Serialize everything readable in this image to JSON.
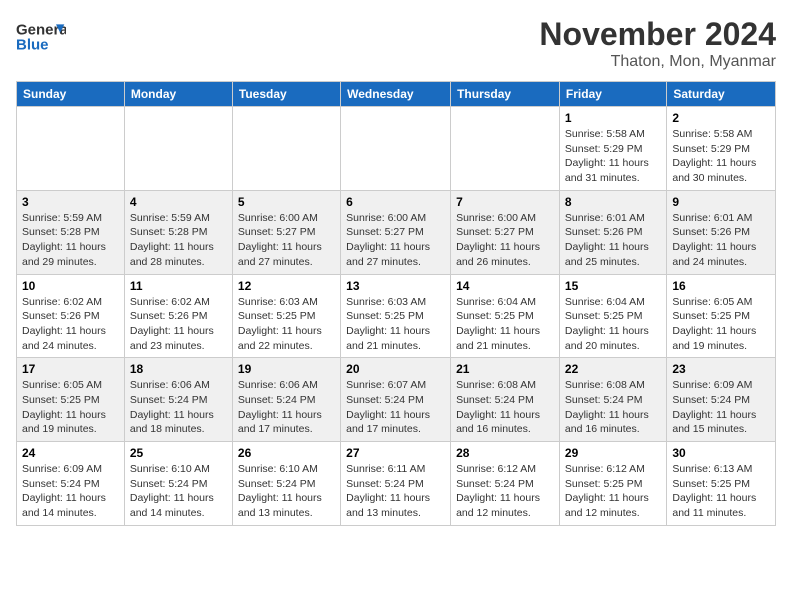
{
  "header": {
    "logo_line1": "General",
    "logo_line2": "Blue",
    "month": "November 2024",
    "location": "Thaton, Mon, Myanmar"
  },
  "days_of_week": [
    "Sunday",
    "Monday",
    "Tuesday",
    "Wednesday",
    "Thursday",
    "Friday",
    "Saturday"
  ],
  "weeks": [
    {
      "days": [
        {
          "num": "",
          "info": ""
        },
        {
          "num": "",
          "info": ""
        },
        {
          "num": "",
          "info": ""
        },
        {
          "num": "",
          "info": ""
        },
        {
          "num": "",
          "info": ""
        },
        {
          "num": "1",
          "info": "Sunrise: 5:58 AM\nSunset: 5:29 PM\nDaylight: 11 hours and 31 minutes."
        },
        {
          "num": "2",
          "info": "Sunrise: 5:58 AM\nSunset: 5:29 PM\nDaylight: 11 hours and 30 minutes."
        }
      ]
    },
    {
      "days": [
        {
          "num": "3",
          "info": "Sunrise: 5:59 AM\nSunset: 5:28 PM\nDaylight: 11 hours and 29 minutes."
        },
        {
          "num": "4",
          "info": "Sunrise: 5:59 AM\nSunset: 5:28 PM\nDaylight: 11 hours and 28 minutes."
        },
        {
          "num": "5",
          "info": "Sunrise: 6:00 AM\nSunset: 5:27 PM\nDaylight: 11 hours and 27 minutes."
        },
        {
          "num": "6",
          "info": "Sunrise: 6:00 AM\nSunset: 5:27 PM\nDaylight: 11 hours and 27 minutes."
        },
        {
          "num": "7",
          "info": "Sunrise: 6:00 AM\nSunset: 5:27 PM\nDaylight: 11 hours and 26 minutes."
        },
        {
          "num": "8",
          "info": "Sunrise: 6:01 AM\nSunset: 5:26 PM\nDaylight: 11 hours and 25 minutes."
        },
        {
          "num": "9",
          "info": "Sunrise: 6:01 AM\nSunset: 5:26 PM\nDaylight: 11 hours and 24 minutes."
        }
      ]
    },
    {
      "days": [
        {
          "num": "10",
          "info": "Sunrise: 6:02 AM\nSunset: 5:26 PM\nDaylight: 11 hours and 24 minutes."
        },
        {
          "num": "11",
          "info": "Sunrise: 6:02 AM\nSunset: 5:26 PM\nDaylight: 11 hours and 23 minutes."
        },
        {
          "num": "12",
          "info": "Sunrise: 6:03 AM\nSunset: 5:25 PM\nDaylight: 11 hours and 22 minutes."
        },
        {
          "num": "13",
          "info": "Sunrise: 6:03 AM\nSunset: 5:25 PM\nDaylight: 11 hours and 21 minutes."
        },
        {
          "num": "14",
          "info": "Sunrise: 6:04 AM\nSunset: 5:25 PM\nDaylight: 11 hours and 21 minutes."
        },
        {
          "num": "15",
          "info": "Sunrise: 6:04 AM\nSunset: 5:25 PM\nDaylight: 11 hours and 20 minutes."
        },
        {
          "num": "16",
          "info": "Sunrise: 6:05 AM\nSunset: 5:25 PM\nDaylight: 11 hours and 19 minutes."
        }
      ]
    },
    {
      "days": [
        {
          "num": "17",
          "info": "Sunrise: 6:05 AM\nSunset: 5:25 PM\nDaylight: 11 hours and 19 minutes."
        },
        {
          "num": "18",
          "info": "Sunrise: 6:06 AM\nSunset: 5:24 PM\nDaylight: 11 hours and 18 minutes."
        },
        {
          "num": "19",
          "info": "Sunrise: 6:06 AM\nSunset: 5:24 PM\nDaylight: 11 hours and 17 minutes."
        },
        {
          "num": "20",
          "info": "Sunrise: 6:07 AM\nSunset: 5:24 PM\nDaylight: 11 hours and 17 minutes."
        },
        {
          "num": "21",
          "info": "Sunrise: 6:08 AM\nSunset: 5:24 PM\nDaylight: 11 hours and 16 minutes."
        },
        {
          "num": "22",
          "info": "Sunrise: 6:08 AM\nSunset: 5:24 PM\nDaylight: 11 hours and 16 minutes."
        },
        {
          "num": "23",
          "info": "Sunrise: 6:09 AM\nSunset: 5:24 PM\nDaylight: 11 hours and 15 minutes."
        }
      ]
    },
    {
      "days": [
        {
          "num": "24",
          "info": "Sunrise: 6:09 AM\nSunset: 5:24 PM\nDaylight: 11 hours and 14 minutes."
        },
        {
          "num": "25",
          "info": "Sunrise: 6:10 AM\nSunset: 5:24 PM\nDaylight: 11 hours and 14 minutes."
        },
        {
          "num": "26",
          "info": "Sunrise: 6:10 AM\nSunset: 5:24 PM\nDaylight: 11 hours and 13 minutes."
        },
        {
          "num": "27",
          "info": "Sunrise: 6:11 AM\nSunset: 5:24 PM\nDaylight: 11 hours and 13 minutes."
        },
        {
          "num": "28",
          "info": "Sunrise: 6:12 AM\nSunset: 5:24 PM\nDaylight: 11 hours and 12 minutes."
        },
        {
          "num": "29",
          "info": "Sunrise: 6:12 AM\nSunset: 5:25 PM\nDaylight: 11 hours and 12 minutes."
        },
        {
          "num": "30",
          "info": "Sunrise: 6:13 AM\nSunset: 5:25 PM\nDaylight: 11 hours and 11 minutes."
        }
      ]
    }
  ]
}
